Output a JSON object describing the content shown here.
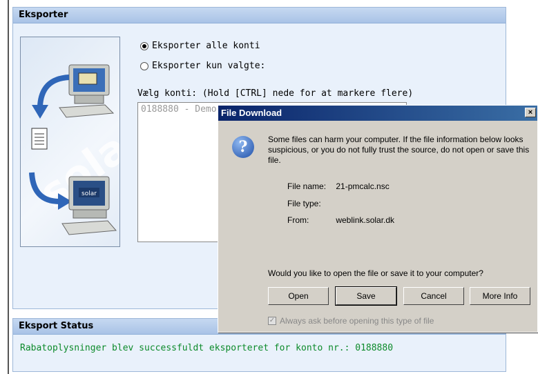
{
  "export_panel": {
    "title": "Eksporter",
    "option_all": "Eksporter alle konti",
    "option_selected": "Eksporter kun valgte:",
    "select_label": "Vælg konti: (Hold [CTRL] nede for at markere flere)",
    "list_items": [
      "0188880 - Demo"
    ],
    "illustration_watermark": "solar"
  },
  "status_panel": {
    "title": "Eksport Status",
    "message": "Rabatoplysninger blev successfuldt eksporteret for konto nr.: 0188880"
  },
  "dialog": {
    "title": "File Download",
    "close_glyph": "×",
    "warning": "Some files can harm your computer. If the file information below looks suspicious, or you do not fully trust the source, do not open or save this file.",
    "file_name_label": "File name:",
    "file_name_value": "21-pmcalc.nsc",
    "file_type_label": "File type:",
    "file_type_value": "",
    "from_label": "From:",
    "from_value": "weblink.solar.dk",
    "question": "Would you like to open the file or save it to your computer?",
    "buttons": {
      "open": "Open",
      "save": "Save",
      "cancel": "Cancel",
      "more_info": "More Info"
    },
    "checkbox_label": "Always ask before opening this type of file",
    "checkbox_checked": true
  },
  "icons": {
    "question": "question-icon",
    "computer_top": "computer-icon",
    "document": "document-icon",
    "computer_solar": "computer-icon",
    "arrow": "curved-arrow-icon"
  },
  "colors": {
    "panel_header": "#a9c3e6",
    "panel_bg": "#e9f1fb",
    "status_text": "#0c8a2a",
    "dialog_title": "#0a246a",
    "dialog_bg": "#d4d0c8"
  }
}
